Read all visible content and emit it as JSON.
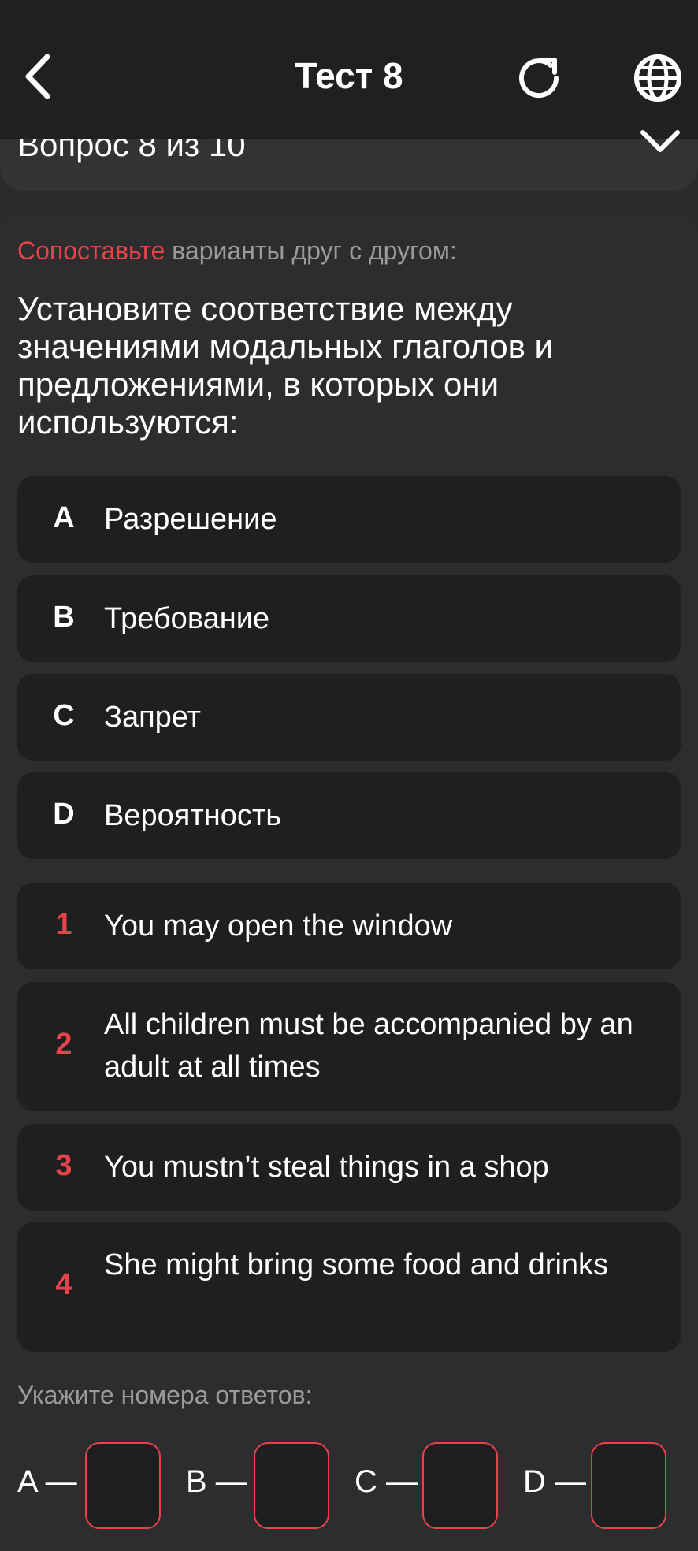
{
  "header": {
    "title": "Тест 8",
    "back_icon": "back-chevron-icon",
    "reload_icon": "reload-icon",
    "globe_icon": "globe-icon"
  },
  "progress": {
    "label": "Вопрос 8 из 10",
    "expand_icon": "chevron-down-icon"
  },
  "instruction": {
    "accent": "Сопоставьте",
    "rest": " варианты друг с другом:"
  },
  "question": "Установите соответствие между значениями модальных глаголов и предложениями, в которых они используются:",
  "options": [
    {
      "key": "A",
      "text": "Разрешение"
    },
    {
      "key": "B",
      "text": "Требование"
    },
    {
      "key": "C",
      "text": "Запрет"
    },
    {
      "key": "D",
      "text": "Вероятность"
    }
  ],
  "sentences": [
    {
      "num": "1",
      "text": "You may open the window"
    },
    {
      "num": "2",
      "text": "All children must be accompanied by an adult at all times"
    },
    {
      "num": "3",
      "text": "You mustn’t steal things in a shop"
    },
    {
      "num": "4",
      "text": "She might bring some food and drinks"
    }
  ],
  "answers": {
    "label": "Укажите номера ответов:",
    "slots": [
      {
        "letter": "A —",
        "value": ""
      },
      {
        "letter": "B —",
        "value": ""
      },
      {
        "letter": "C —",
        "value": ""
      },
      {
        "letter": "D —",
        "value": ""
      }
    ]
  },
  "colors": {
    "accent": "#e8424b",
    "background": "#2b2b2d",
    "card": "#1f1f21",
    "muted_text": "#9b9b9d"
  }
}
